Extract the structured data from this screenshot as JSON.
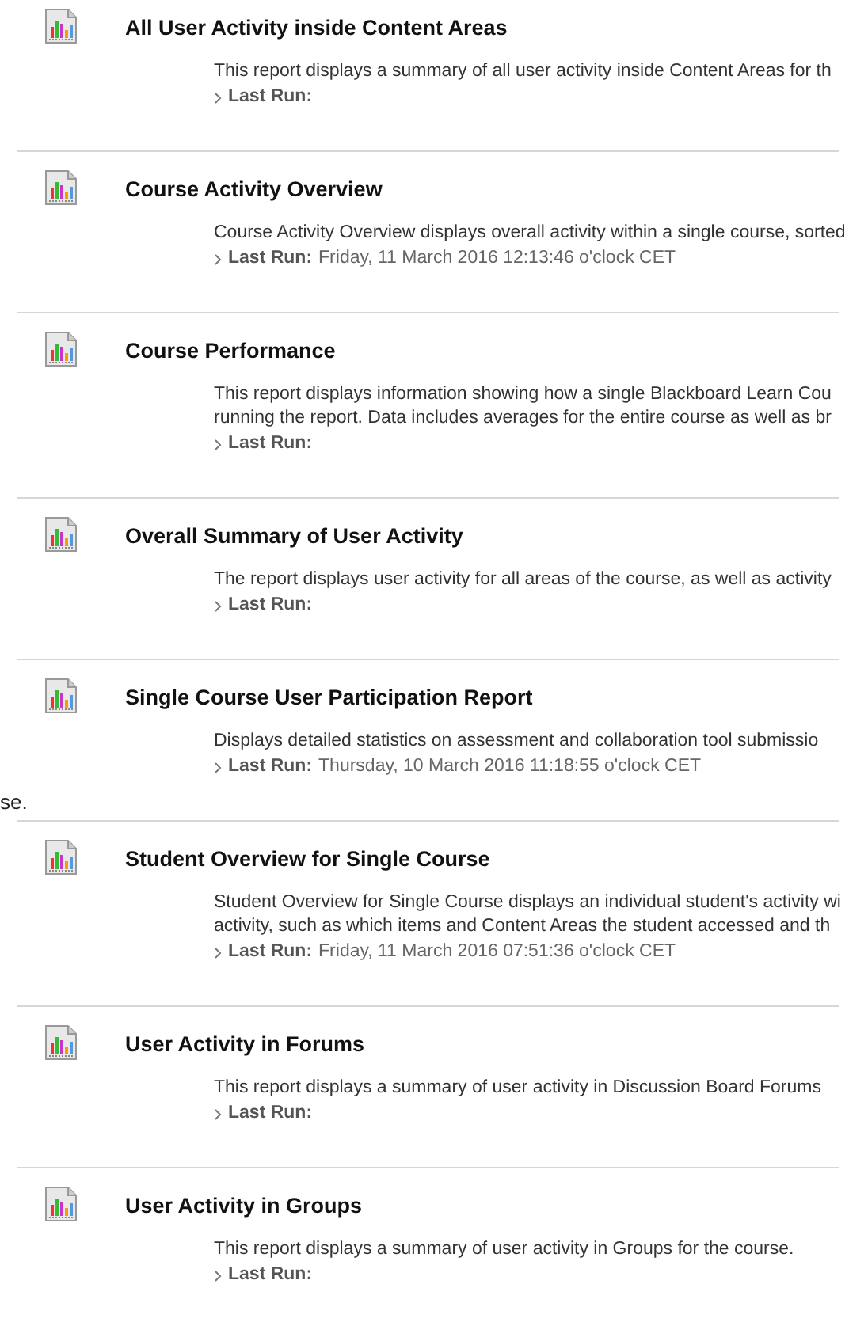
{
  "side_fragment": "se.",
  "reports": [
    {
      "title": "All User Activity inside Content Areas",
      "description": [
        "This report displays a summary of all user activity inside Content Areas for th"
      ],
      "last_run_label": "Last Run:"
    },
    {
      "title": "Course Activity Overview",
      "description": [
        "Course Activity Overview displays overall activity within a single course, sorted"
      ],
      "last_run_label": "Last Run:",
      "last_run": "Friday, 11 March 2016 12:13:46 o'clock CET"
    },
    {
      "title": "Course Performance",
      "description": [
        "This report displays information showing how a single Blackboard Learn Cou",
        "running the report. Data includes averages for the entire course as well as br"
      ],
      "last_run_label": "Last Run:"
    },
    {
      "title": "Overall Summary of User Activity",
      "description": [
        "The report displays user activity for all areas of the course, as well as activity"
      ],
      "last_run_label": "Last Run:"
    },
    {
      "title": "Single Course User Participation Report",
      "description": [
        "Displays detailed statistics on assessment and collaboration tool submissio"
      ],
      "last_run_label": "Last Run:",
      "last_run": "Thursday, 10 March 2016 11:18:55 o'clock CET"
    },
    {
      "title": "Student Overview for Single Course",
      "description": [
        "Student Overview for Single Course displays an individual student's activity wi",
        "activity, such as which items and Content Areas the student accessed and th"
      ],
      "last_run_label": "Last Run:",
      "last_run": "Friday, 11 March 2016 07:51:36 o'clock CET"
    },
    {
      "title": "User Activity in Forums",
      "description": [
        "This report displays a summary of user activity in Discussion Board Forums"
      ],
      "last_run_label": "Last Run:"
    },
    {
      "title": "User Activity in Groups",
      "description": [
        "This report displays a summary of user activity in Groups for the course."
      ],
      "last_run_label": "Last Run:"
    }
  ]
}
